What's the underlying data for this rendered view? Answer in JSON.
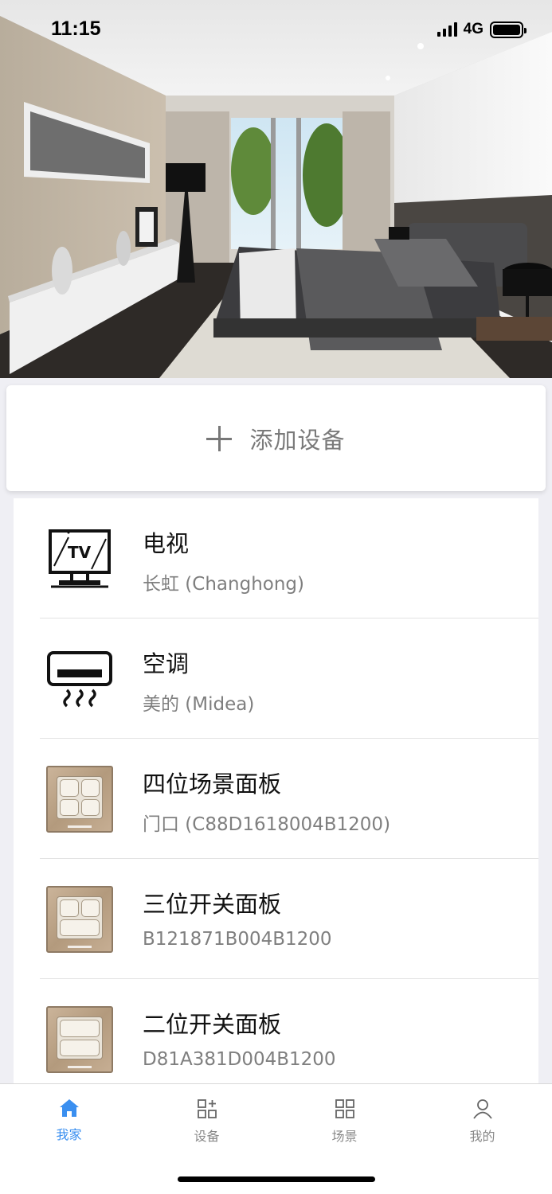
{
  "status_bar": {
    "time": "11:15",
    "network": "4G",
    "battery_level": 1.0
  },
  "hero": {
    "image": "bedroom-interior-photo"
  },
  "add_device": {
    "label": "添加设备",
    "icon": "plus-icon"
  },
  "devices": [
    {
      "name": "电视",
      "subtitle": "长虹 (Changhong)",
      "icon": "tv-icon"
    },
    {
      "name": "空调",
      "subtitle": "美的 (Midea)",
      "icon": "air-conditioner-icon"
    },
    {
      "name": "四位场景面板",
      "subtitle": "门口 (C88D1618004B1200)",
      "icon": "four-button-panel-icon"
    },
    {
      "name": "三位开关面板",
      "subtitle": "B121871B004B1200",
      "icon": "three-button-panel-icon"
    },
    {
      "name": "二位开关面板",
      "subtitle": "D81A381D004B1200",
      "icon": "two-button-panel-icon"
    }
  ],
  "tabs": [
    {
      "label": "我家",
      "icon": "home-icon",
      "active": true
    },
    {
      "label": "设备",
      "icon": "devices-icon",
      "active": false
    },
    {
      "label": "场景",
      "icon": "scenes-icon",
      "active": false
    },
    {
      "label": "我的",
      "icon": "profile-icon",
      "active": false
    }
  ],
  "colors": {
    "accent": "#3a8ff0",
    "background": "#efeff4"
  }
}
